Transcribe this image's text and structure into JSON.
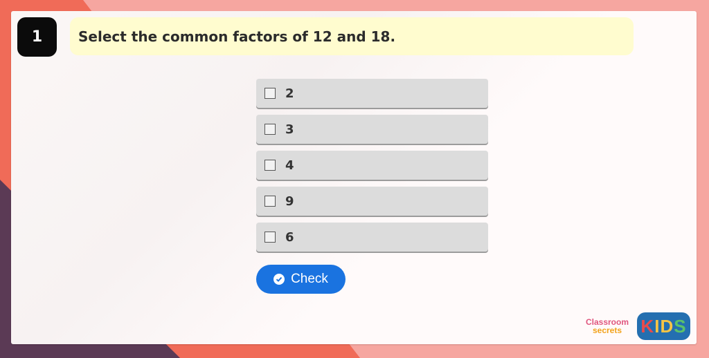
{
  "question": {
    "number": "1",
    "text": "Select the common factors of 12 and 18."
  },
  "options": [
    {
      "label": "2",
      "checked": false
    },
    {
      "label": "3",
      "checked": false
    },
    {
      "label": "4",
      "checked": false
    },
    {
      "label": "9",
      "checked": false
    },
    {
      "label": "6",
      "checked": false
    }
  ],
  "check_button": {
    "label": "Check",
    "icon": "check-circle-icon"
  },
  "branding": {
    "classroom_secrets_line1": "Classroom",
    "classroom_secrets_line2": "secrets",
    "kids_letters": [
      "K",
      "I",
      "D",
      "S"
    ],
    "kids_colors": [
      "#e94b4b",
      "#f6c445",
      "#f6c445",
      "#5bc26a"
    ]
  },
  "colors": {
    "accent": "#1a73e0",
    "question_bg": "#fffccf",
    "option_bg": "#dcdcdc"
  }
}
